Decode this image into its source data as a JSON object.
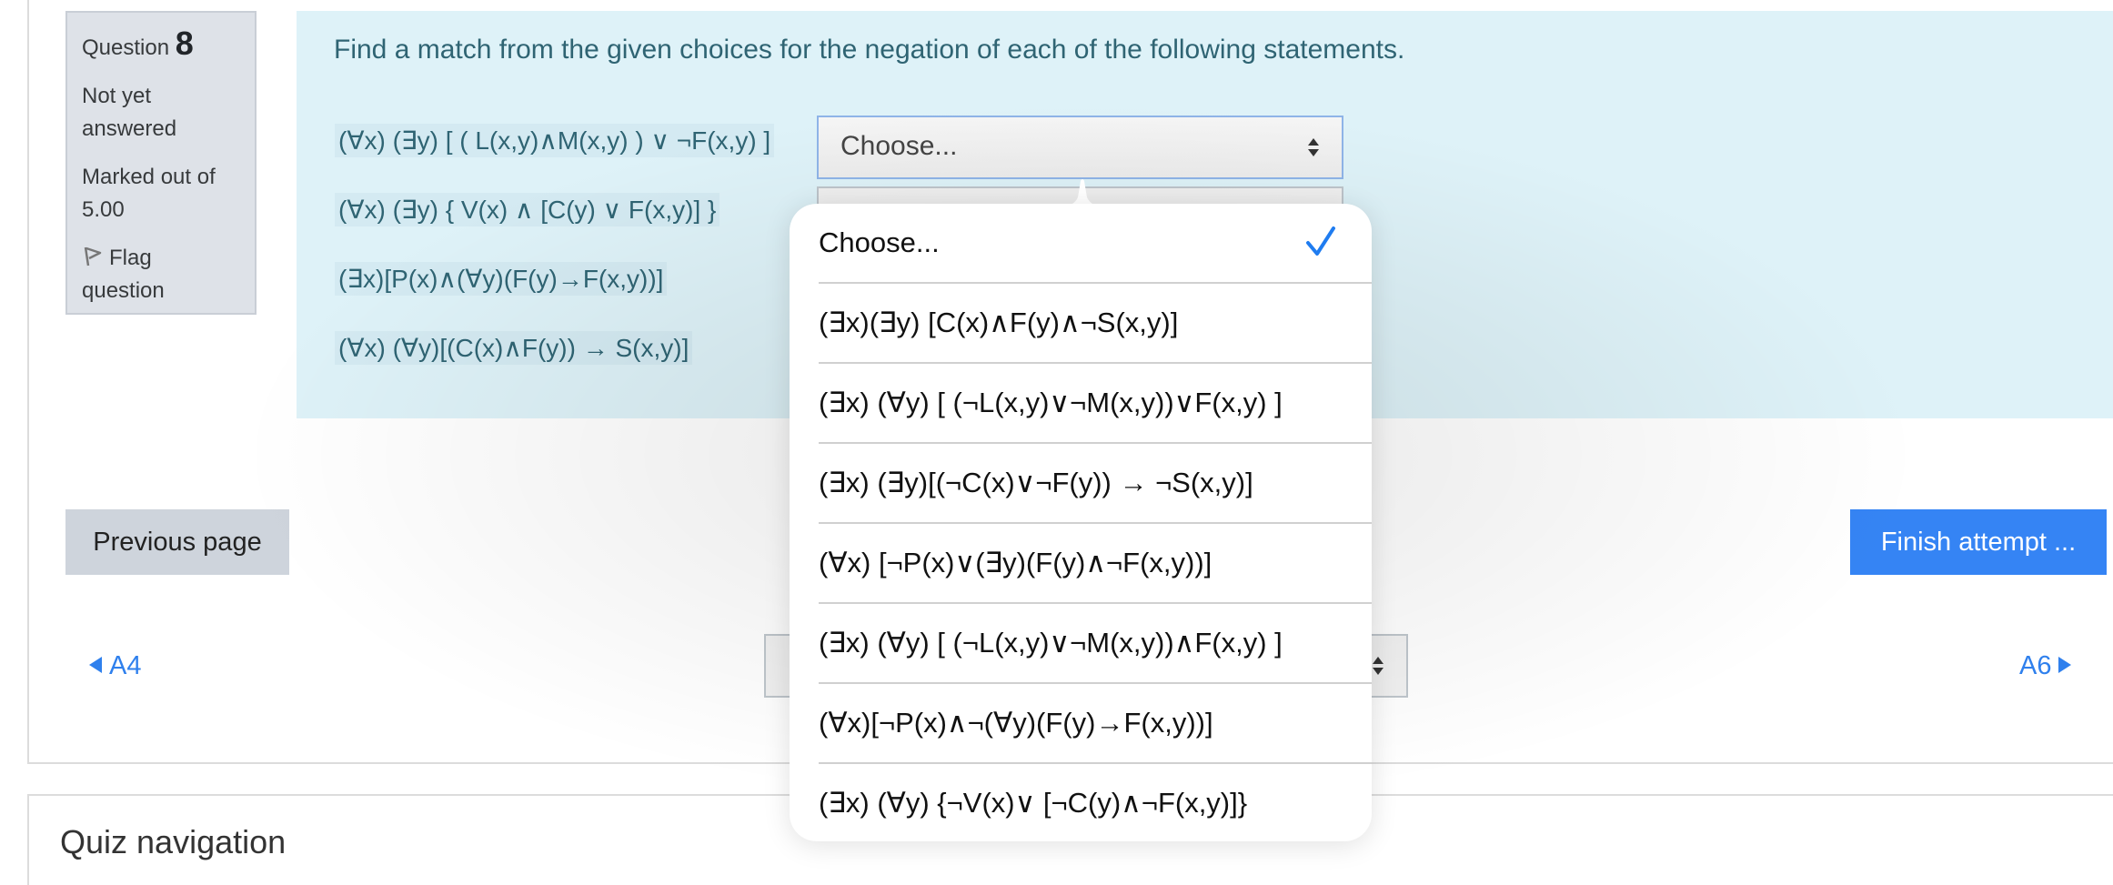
{
  "question_info": {
    "label": "Question",
    "number": "8",
    "status": "Not yet answered",
    "marked_label": "Marked out of",
    "marks": "5.00",
    "flag_label": "Flag question"
  },
  "question": {
    "text": "Find a match from the given choices for the negation of each of the following statements.",
    "statements": [
      "(∀x) (∃y)   [ ( L(x,y)∧M(x,y) ) ∨ ¬F(x,y) ]",
      "(∀x) (∃y) { V(x) ∧ [C(y) ∨ F(x,y)] }",
      "(∃x)[P(x)∧(∀y)(F(y)→F(x,y))]",
      "(∀x) (∀y)[(C(x)∧F(y)) → S(x,y)]"
    ],
    "selects": [
      {
        "value": "Choose...",
        "focused": true
      },
      {
        "value": ""
      },
      {
        "value": ""
      },
      {
        "value": ""
      }
    ]
  },
  "dropdown": {
    "selected": "Choose...",
    "options": [
      "Choose...",
      "(∃x)(∃y) [C(x)∧F(y)∧¬S(x,y)]",
      "(∃x) (∀y) [ (¬L(x,y)∨¬M(x,y))∨F(x,y) ]",
      "(∃x) (∃y)[(¬C(x)∨¬F(y)) → ¬S(x,y)]",
      "(∀x) [¬P(x)∨(∃y)(F(y)∧¬F(x,y))]",
      "(∃x) (∀y) [ (¬L(x,y)∨¬M(x,y))∧F(x,y) ]",
      "(∀x)[¬P(x)∧¬(∀y)(F(y)→F(x,y))]",
      "(∃x) (∀y) {¬V(x)∨ [¬C(y)∧¬F(x,y)]}"
    ]
  },
  "navigation": {
    "previous_label": "Previous page",
    "finish_label": "Finish attempt ...",
    "prev_link": "A4",
    "next_link": "A6",
    "jump_select_value": ""
  },
  "quiz_nav": {
    "title": "Quiz navigation"
  },
  "colors": {
    "accent": "#3584f4",
    "link": "#2f80ed",
    "content_bg": "#def2f8",
    "statement_text": "#2f6473",
    "info_bg": "#dee2e8",
    "check": "#1f7cf0"
  }
}
